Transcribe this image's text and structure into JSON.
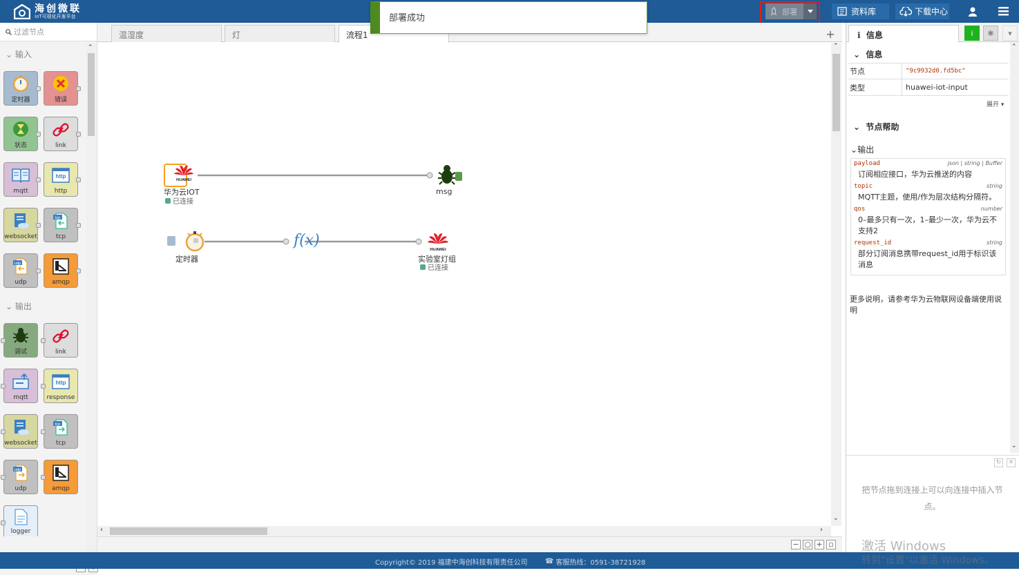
{
  "header": {
    "logo_title": "海创微联",
    "logo_subtitle": "IoT可视化开发平台",
    "deploy_label": "部署",
    "library_label": "资料库",
    "download_label": "下载中心"
  },
  "notification": {
    "message": "部署成功"
  },
  "palette": {
    "filter_placeholder": "过滤节点",
    "input_category": "输入",
    "output_category": "输出",
    "input_nodes": [
      "定时器",
      "错误",
      "状态",
      "link",
      "mqtt",
      "http",
      "websocket",
      "tcp",
      "udp",
      "amqp"
    ],
    "output_nodes": [
      "调试",
      "link",
      "mqtt",
      "response",
      "websocket",
      "tcp",
      "udp",
      "amqp",
      "logger"
    ]
  },
  "workspace": {
    "tabs": [
      "温湿度",
      "灯",
      "流程1"
    ],
    "flow": {
      "huawei_in": {
        "label": "华为云IOT",
        "status": "已连接",
        "brand": "HUAWEI"
      },
      "debug": {
        "label": "msg"
      },
      "timer": {
        "label": "定时器"
      },
      "function": {
        "label": "f(x)"
      },
      "huawei_out": {
        "label": "实验室灯组",
        "status": "已连接",
        "brand": "HUAWEI"
      }
    }
  },
  "sidebar": {
    "tab_info": "信息",
    "section_info": "信息",
    "node_key": "节点",
    "node_value": "\"9c9932d0.fd5bc\"",
    "type_key": "类型",
    "type_value": "huawei-iot-input",
    "expand": "展开",
    "section_help": "节点帮助",
    "output_title": "输出",
    "props": [
      {
        "name": "payload",
        "type": "json | string | Buffer",
        "desc": "订阅相应接口，华为云推送的内容"
      },
      {
        "name": "topic",
        "type": "string",
        "desc": "MQTT主题，使用/作为层次结构分隔符。"
      },
      {
        "name": "qos",
        "type": "number",
        "desc": "0–最多只有一次，1–最少一次，华为云不支持2"
      },
      {
        "name": "request_id",
        "type": "string",
        "desc": "部分订阅消息携带request_id用于标识该消息"
      }
    ],
    "more": "更多说明，请参考华为云物联网设备端使用说明",
    "hint": "把节点拖到连接上可以向连接中插入节点。"
  },
  "footer": {
    "copyright": "Copyright© 2019 福建中海创科技有限责任公司",
    "hotline": "客服热线：0591-38721928"
  },
  "watermark": {
    "line1": "激活 Windows",
    "line2": "转到\"设置\"以激活 Windows。"
  },
  "colors": {
    "header": "#1f5b97",
    "deploy_highlight": "#e21c1c",
    "notify_border": "#4e8b1f",
    "huawei_red": "#e0232c"
  }
}
